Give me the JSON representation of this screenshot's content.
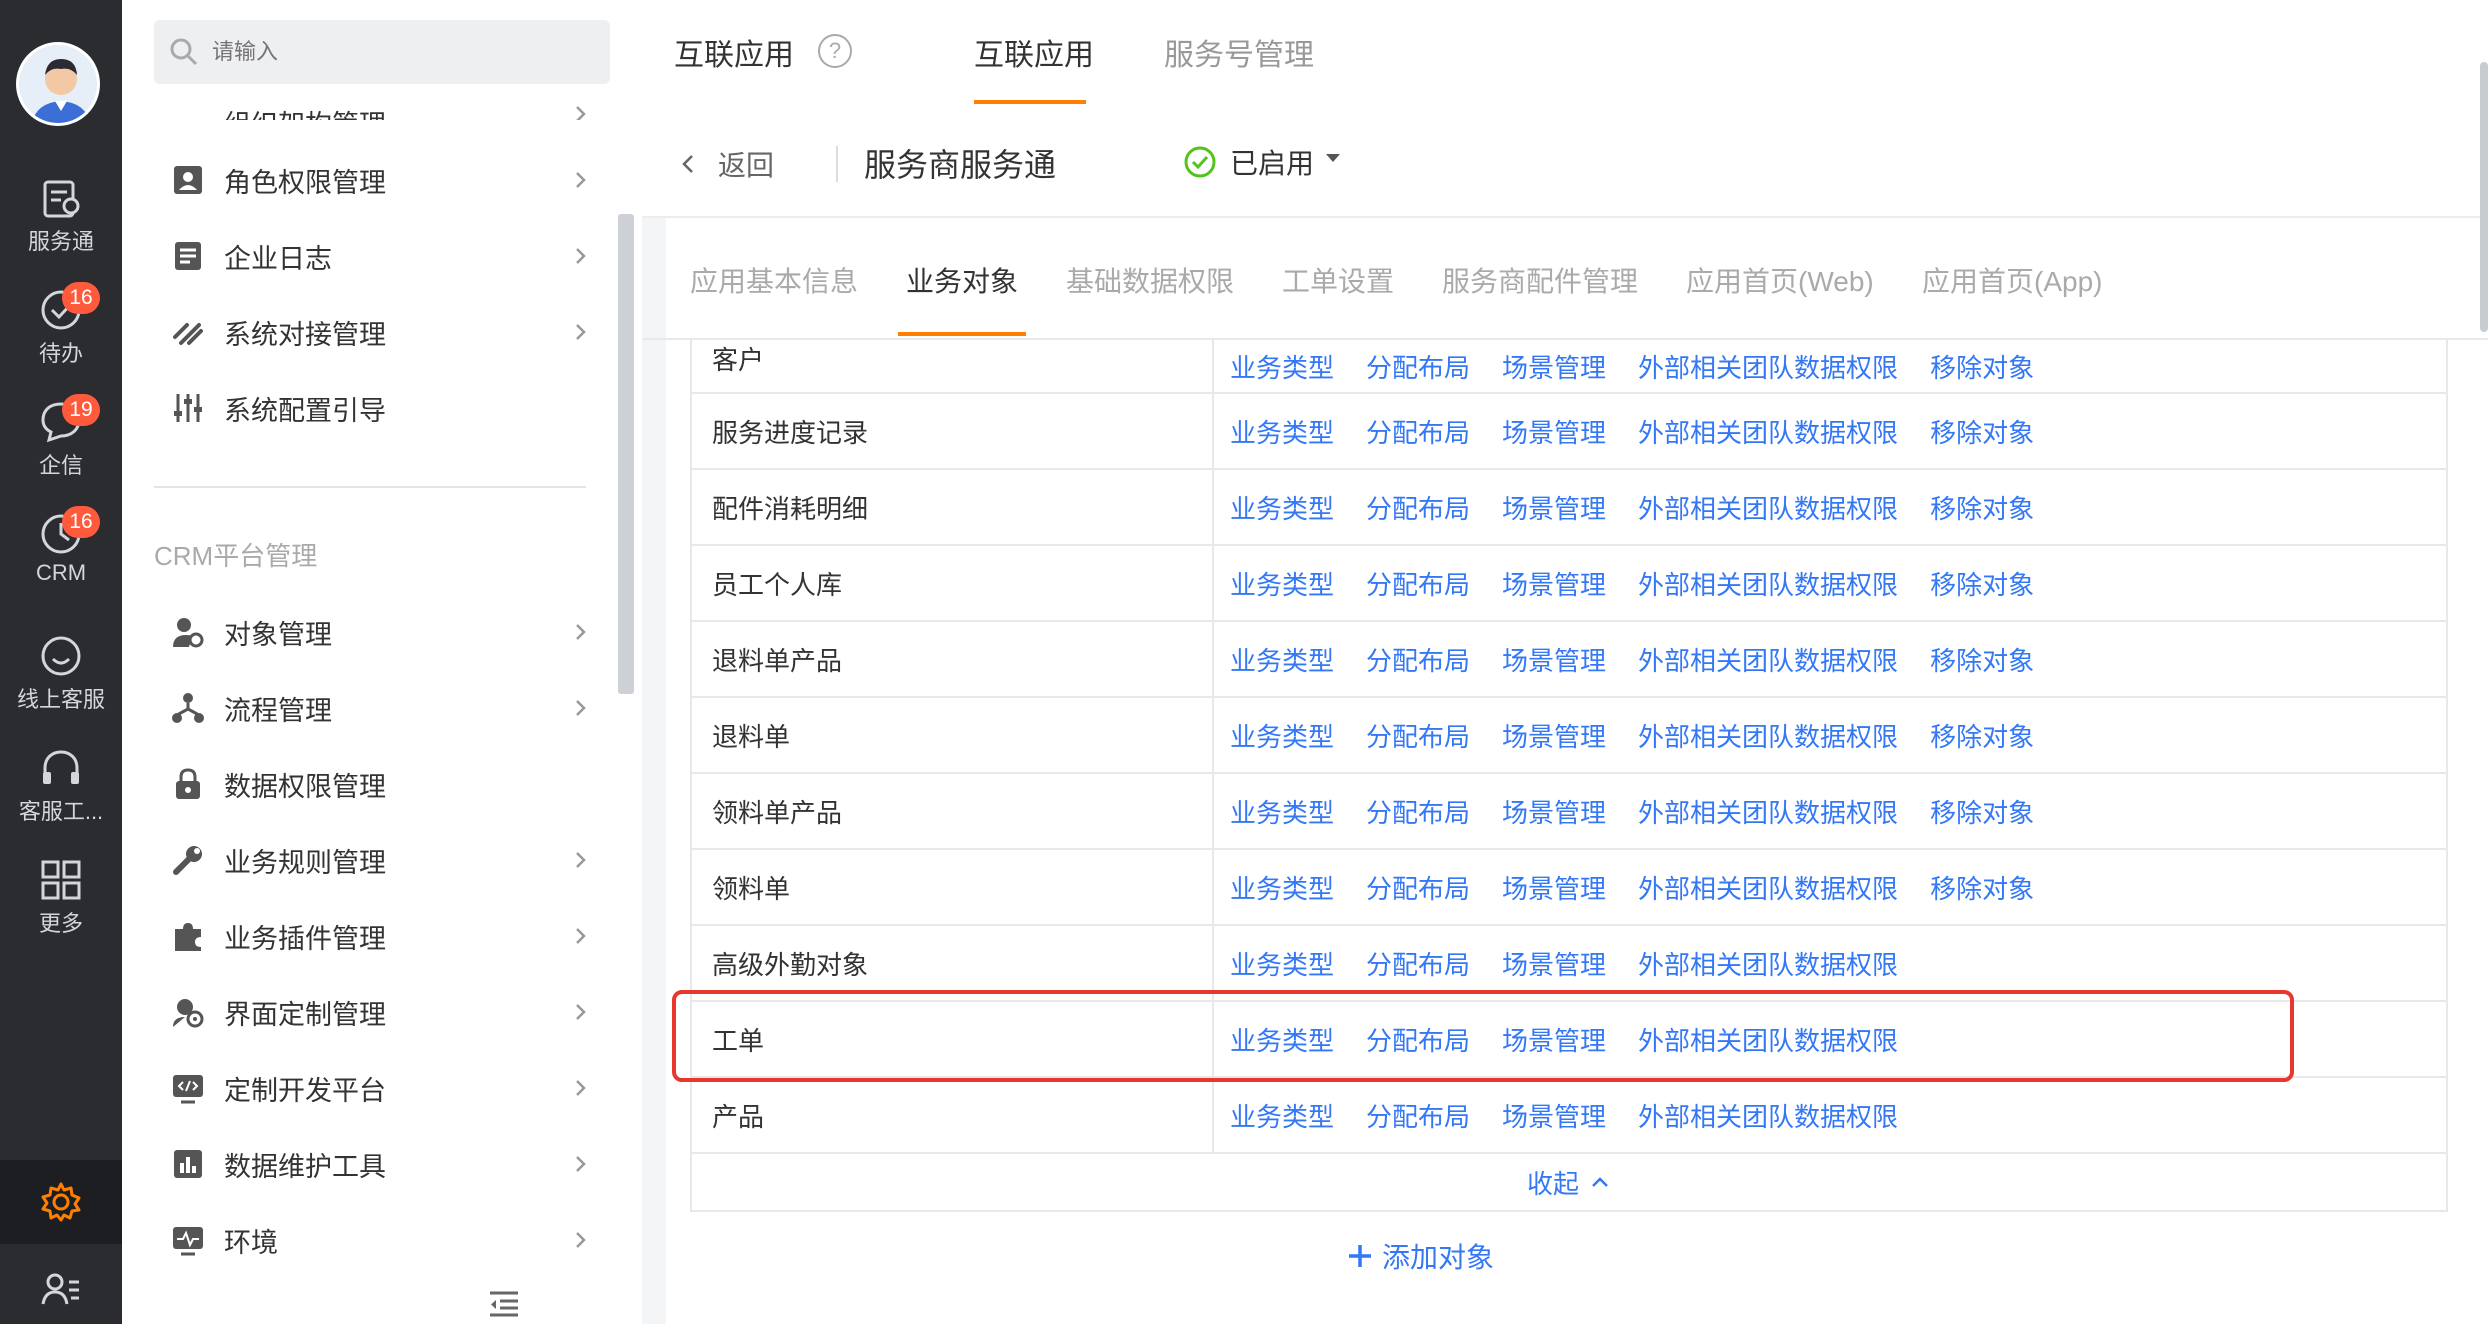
{
  "rail": {
    "items": [
      {
        "label": "服务通",
        "icon": "service-clipboard-icon",
        "badge": ""
      },
      {
        "label": "待办",
        "icon": "todo-check-icon",
        "badge": "16"
      },
      {
        "label": "企信",
        "icon": "chat-bubble-icon",
        "badge": "19"
      },
      {
        "label": "CRM",
        "icon": "clock-icon",
        "badge": "16"
      },
      {
        "label": "线上客服",
        "icon": "smile-icon",
        "badge": ""
      },
      {
        "label": "客服工...",
        "icon": "headset-icon",
        "badge": ""
      },
      {
        "label": "更多",
        "icon": "grid-icon",
        "badge": ""
      }
    ],
    "settings_icon": "gear-icon",
    "bottom_icon": "user-list-icon",
    "accent": "#ff8000"
  },
  "menu": {
    "search_placeholder": "请输入",
    "items": [
      {
        "label": "组织架构管理",
        "icon": "org-icon",
        "has_chevron": true
      },
      {
        "label": "角色权限管理",
        "icon": "role-card-icon",
        "has_chevron": true
      },
      {
        "label": "企业日志",
        "icon": "log-icon",
        "has_chevron": true
      },
      {
        "label": "系统对接管理",
        "icon": "link-icon",
        "has_chevron": true
      },
      {
        "label": "系统配置引导",
        "icon": "sliders-icon",
        "has_chevron": false
      }
    ],
    "section_title": "CRM平台管理",
    "crm_items": [
      {
        "label": "对象管理",
        "icon": "object-gear-icon",
        "has_chevron": true
      },
      {
        "label": "流程管理",
        "icon": "flow-icon",
        "has_chevron": true
      },
      {
        "label": "数据权限管理",
        "icon": "lock-icon",
        "has_chevron": false
      },
      {
        "label": "业务规则管理",
        "icon": "wrench-icon",
        "has_chevron": true
      },
      {
        "label": "业务插件管理",
        "icon": "puzzle-icon",
        "has_chevron": true
      },
      {
        "label": "界面定制管理",
        "icon": "ui-gear-icon",
        "has_chevron": true
      },
      {
        "label": "定制开发平台",
        "icon": "code-monitor-icon",
        "has_chevron": true
      },
      {
        "label": "数据维护工具",
        "icon": "bar-chart-icon",
        "has_chevron": true
      },
      {
        "label": "环境",
        "icon": "pulse-monitor-icon",
        "has_chevron": true
      }
    ]
  },
  "topbar": {
    "title": "互联应用",
    "tabs": [
      "互联应用",
      "服务号管理"
    ],
    "active_tab": "互联应用"
  },
  "subbar": {
    "back_label": "返回",
    "service_name": "服务商服务通",
    "status_label": "已启用",
    "status_color": "#52c41a"
  },
  "tabs2": {
    "items": [
      "应用基本信息",
      "业务对象",
      "基础数据权限",
      "工单设置",
      "服务商配件管理",
      "应用首页(Web)",
      "应用首页(App)"
    ],
    "active": "业务对象"
  },
  "table": {
    "rows": [
      {
        "name": "客户",
        "ops": [
          "业务类型",
          "分配布局",
          "场景管理",
          "外部相关团队数据权限",
          "移除对象"
        ]
      },
      {
        "name": "服务进度记录",
        "ops": [
          "业务类型",
          "分配布局",
          "场景管理",
          "外部相关团队数据权限",
          "移除对象"
        ]
      },
      {
        "name": "配件消耗明细",
        "ops": [
          "业务类型",
          "分配布局",
          "场景管理",
          "外部相关团队数据权限",
          "移除对象"
        ]
      },
      {
        "name": "员工个人库",
        "ops": [
          "业务类型",
          "分配布局",
          "场景管理",
          "外部相关团队数据权限",
          "移除对象"
        ]
      },
      {
        "name": "退料单产品",
        "ops": [
          "业务类型",
          "分配布局",
          "场景管理",
          "外部相关团队数据权限",
          "移除对象"
        ]
      },
      {
        "name": "退料单",
        "ops": [
          "业务类型",
          "分配布局",
          "场景管理",
          "外部相关团队数据权限",
          "移除对象"
        ]
      },
      {
        "name": "领料单产品",
        "ops": [
          "业务类型",
          "分配布局",
          "场景管理",
          "外部相关团队数据权限",
          "移除对象"
        ]
      },
      {
        "name": "领料单",
        "ops": [
          "业务类型",
          "分配布局",
          "场景管理",
          "外部相关团队数据权限",
          "移除对象"
        ]
      },
      {
        "name": "高级外勤对象",
        "ops": [
          "业务类型",
          "分配布局",
          "场景管理",
          "外部相关团队数据权限"
        ]
      },
      {
        "name": "工单",
        "ops": [
          "业务类型",
          "分配布局",
          "场景管理",
          "外部相关团队数据权限"
        ]
      },
      {
        "name": "产品",
        "ops": [
          "业务类型",
          "分配布局",
          "场景管理",
          "外部相关团队数据权限"
        ]
      }
    ],
    "collapse_label": "收起",
    "link_color": "#3478f6",
    "highlight_color": "#e8382e",
    "highlighted_row": "工单"
  },
  "add_object_label": "添加对象"
}
